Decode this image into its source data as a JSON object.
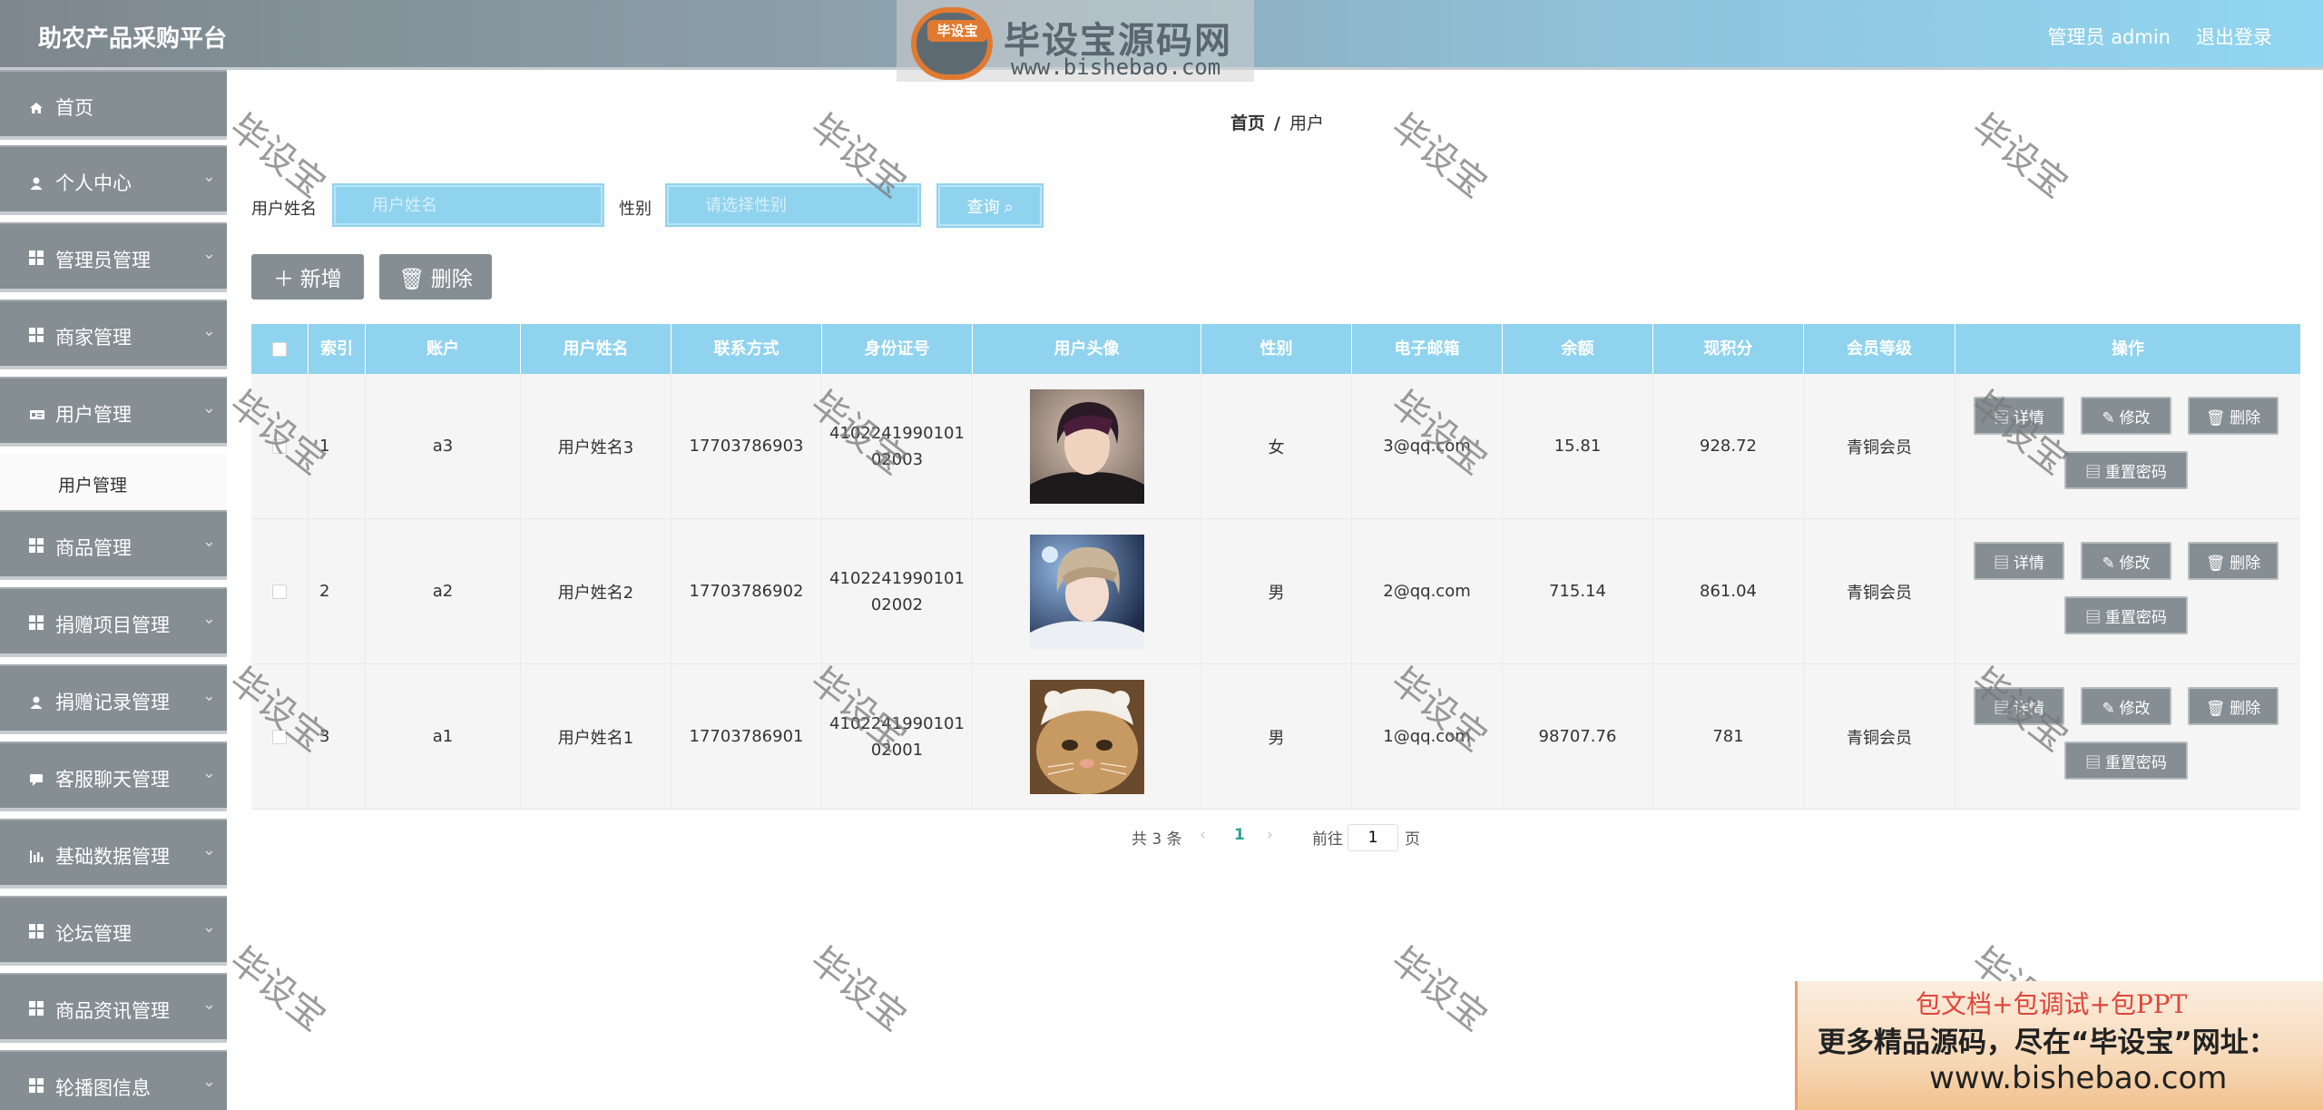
{
  "header": {
    "title": "助农产品采购平台",
    "user_label": "管理员 admin",
    "logout_label": "退出登录"
  },
  "logo": {
    "emblem_text": "毕设宝",
    "title": "毕设宝源码网",
    "url": "www.bishebao.com"
  },
  "sidebar": {
    "items": [
      {
        "label": "首页",
        "icon": "home-icon",
        "has_arrow": false
      },
      {
        "label": "个人中心",
        "icon": "person-icon",
        "has_arrow": true
      },
      {
        "label": "管理员管理",
        "icon": "grid-icon",
        "has_arrow": true
      },
      {
        "label": "商家管理",
        "icon": "grid-icon",
        "has_arrow": true
      },
      {
        "label": "用户管理",
        "icon": "id-card-icon",
        "has_arrow": true
      },
      {
        "label": "商品管理",
        "icon": "grid-icon",
        "has_arrow": true
      },
      {
        "label": "捐赠项目管理",
        "icon": "grid-icon",
        "has_arrow": true
      },
      {
        "label": "捐赠记录管理",
        "icon": "person-icon",
        "has_arrow": true
      },
      {
        "label": "客服聊天管理",
        "icon": "chat-icon",
        "has_arrow": true
      },
      {
        "label": "基础数据管理",
        "icon": "bar-chart-icon",
        "has_arrow": true
      },
      {
        "label": "论坛管理",
        "icon": "grid-icon",
        "has_arrow": true
      },
      {
        "label": "商品资讯管理",
        "icon": "grid-icon",
        "has_arrow": true
      },
      {
        "label": "轮播图信息",
        "icon": "grid-icon",
        "has_arrow": true
      }
    ],
    "submenu": {
      "label": "用户管理"
    }
  },
  "breadcrumb": {
    "home": "首页",
    "separator": "/",
    "current": "用户"
  },
  "search": {
    "name_label": "用户姓名",
    "name_placeholder": "用户姓名",
    "gender_label": "性别",
    "gender_placeholder": "请选择性别",
    "query_label": "查询 ⌕"
  },
  "actions": {
    "add_label": "＋ 新增",
    "delete_label": "🗑 删除"
  },
  "table": {
    "columns": [
      "索引",
      "账户",
      "用户姓名",
      "联系方式",
      "身份证号",
      "用户头像",
      "性别",
      "电子邮箱",
      "余额",
      "现积分",
      "会员等级",
      "操作"
    ],
    "rows": [
      {
        "index": "1",
        "account": "a3",
        "name": "用户姓名3",
        "phone": "17703786903",
        "id_line1": "4102241990101",
        "id_line2": "02003",
        "gender": "女",
        "email": "3@qq.com",
        "balance": "15.81",
        "points": "928.72",
        "level": "青铜会员",
        "avatar": "dark-hair-avatar"
      },
      {
        "index": "2",
        "account": "a2",
        "name": "用户姓名2",
        "phone": "17703786902",
        "id_line1": "4102241990101",
        "id_line2": "02002",
        "gender": "男",
        "email": "2@qq.com",
        "balance": "715.14",
        "points": "861.04",
        "level": "青铜会员",
        "avatar": "light-hair-avatar"
      },
      {
        "index": "3",
        "account": "a1",
        "name": "用户姓名1",
        "phone": "17703786901",
        "id_line1": "4102241990101",
        "id_line2": "02001",
        "gender": "男",
        "email": "1@qq.com",
        "balance": "98707.76",
        "points": "781",
        "level": "青铜会员",
        "avatar": "cat-avatar"
      }
    ],
    "row_actions": {
      "detail": "▤ 详情",
      "edit": "✎ 修改",
      "delete": "🗑 删除",
      "reset": "▤ 重置密码"
    }
  },
  "pagination": {
    "total": "共 3 条",
    "prev": "‹",
    "current": "1",
    "next": "›",
    "goto_label": "前往",
    "goto_value": "1",
    "page_suffix": "页"
  },
  "watermark": {
    "text": "毕设宝"
  },
  "promo": {
    "line1": "包文档+包调试+包PPT",
    "line2": "更多精品源码，尽在“毕设宝”网址：",
    "line3": "www.bishebao.com"
  }
}
